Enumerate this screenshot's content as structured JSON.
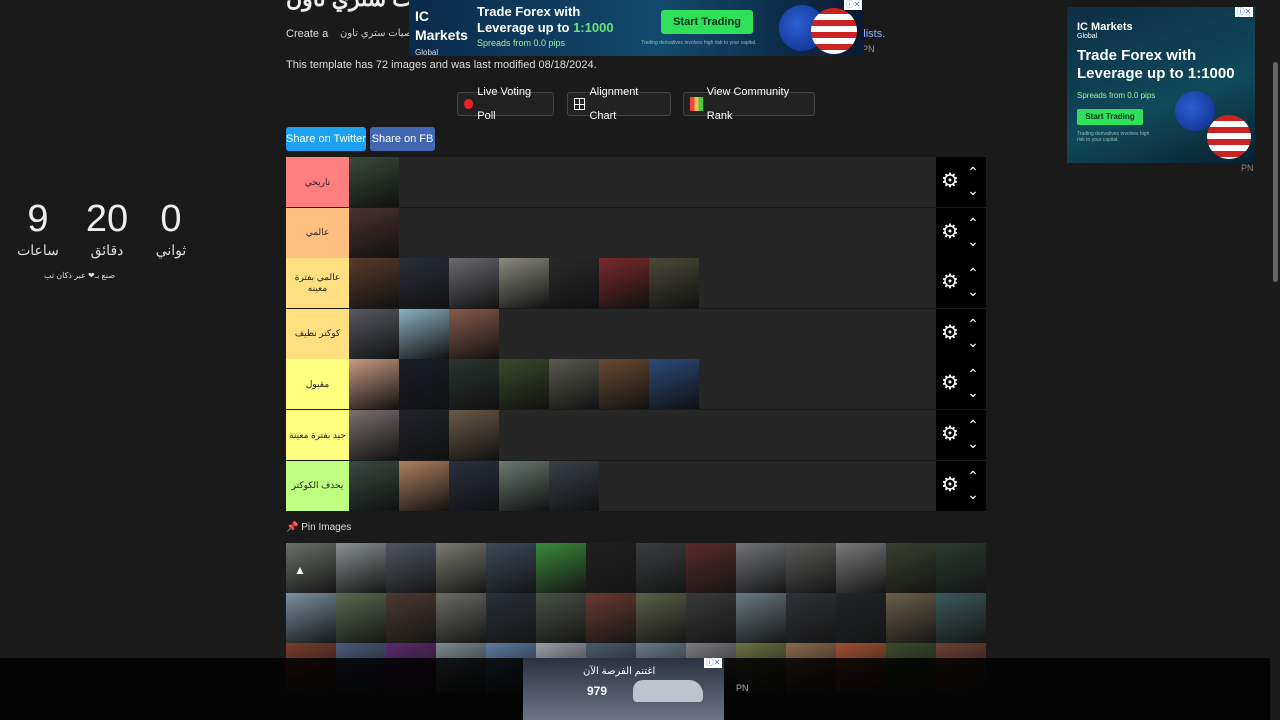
{
  "header": {
    "title": "قائمة شخصيات ستري تاون",
    "intro_start": "Create a",
    "intro_arabic": "شخصيات ستري تاون",
    "intro_link_tail": "ler lists.",
    "intro_pn": "PN",
    "template_info": "This template has 72 images and was last modified 08/18/2024."
  },
  "top_ad": {
    "brand": "IC Markets",
    "brand_sub": "Global",
    "headline_1": "Trade Forex with",
    "headline_2a": "Leverage up to ",
    "headline_2b": "1:1000",
    "sub": "Spreads from 0.0 pips",
    "cta": "Start Trading",
    "disclaimer": "Trading derivatives involves high risk to your capital."
  },
  "actions": {
    "live_voting": "Live Voting Poll",
    "alignment": "Alignment Chart",
    "community_rank": "View Community Rank",
    "share_twitter": "Share on Twitter",
    "share_fb": "Share on FB"
  },
  "tiers": [
    {
      "label": "تاريخي",
      "color": "#ff7f7f",
      "count": 1,
      "imgs": [
        "#3a4a3a"
      ]
    },
    {
      "label": "عالمي",
      "color": "#ffbf7f",
      "count": 1,
      "imgs": [
        "#4a3230"
      ]
    },
    {
      "label": "عالمي بفترة معينه",
      "color": "#ffdf7f",
      "count": 7,
      "imgs": [
        "#5a3b2a",
        "#2a2f3a",
        "#6a6a70",
        "#8a8a80",
        "#2a2a2a",
        "#7a2a2a",
        "#4a4a3a"
      ]
    },
    {
      "label": "كوكتر نظيف",
      "color": "#ffdf7f",
      "count": 3,
      "imgs": [
        "#555a60",
        "#8ab0c0",
        "#8a5a4a"
      ]
    },
    {
      "label": "مقبول",
      "color": "#ffff7f",
      "count": 7,
      "imgs": [
        "#c89a80",
        "#1a1e2a",
        "#2a3530",
        "#3a4a2a",
        "#5a5a50",
        "#6a4a30",
        "#2a4a7a"
      ]
    },
    {
      "label": "جيد بفترة معينة",
      "color": "#ffff7f",
      "count": 3,
      "imgs": [
        "#7a7070",
        "#20242a",
        "#6a5a48"
      ]
    },
    {
      "label": "يحذف الكوكتر",
      "color": "#bfff7f",
      "count": 5,
      "imgs": [
        "#3a4a40",
        "#b08060",
        "#2a3040",
        "#6a7a70",
        "#3a4048"
      ]
    }
  ],
  "pin_images_label": "Pin Images",
  "pool_colors": [
    "#6a7068",
    "#8a9090",
    "#505560",
    "#7a7a72",
    "#3a4a5a",
    "#3a8a3a",
    "#202020",
    "#3a3e40",
    "#5a2a2a",
    "#707478",
    "#5a5a58",
    "#7a7a7a",
    "#3a4030",
    "#2a3a30",
    "#7a90a0",
    "#5a6a50",
    "#4a3a30",
    "#6a6a66",
    "#2a3038",
    "#4a5048",
    "#6a3a30",
    "#5a6048",
    "#3a3a3a",
    "#6a7a80",
    "#303238",
    "#202428",
    "#6a6048",
    "#3a5a5a",
    "#7a3a2a",
    "#4a5a7a",
    "#5a2a6a",
    "#7a8a90",
    "#5a7aa0",
    "#9aa0a8",
    "#4a5a6a",
    "#6a7a8a",
    "#7a7a80",
    "#6a7040",
    "#8a6a4a",
    "#a05030",
    "#3a4a2a",
    "#6a4030"
  ],
  "countdown": {
    "hours": "9",
    "hours_label": "ساعات",
    "minutes": "20",
    "minutes_label": "دقائق",
    "seconds": "0",
    "seconds_label": "ثواني",
    "credit": "صنع بـ❤ عبر ذكان تب"
  },
  "side_ad": {
    "brand": "IC Markets",
    "brand_sub": "Global",
    "h1": "Trade Forex with",
    "h2": "Leverage up to 1:1000",
    "sub": "Spreads from 0.0 pips",
    "cta": "Start Trading",
    "disclaimer": "Trading derivatives involves high risk to your capital.",
    "pn": "PN"
  },
  "bottom_ad": {
    "headline": "اغتنم الفرصة الآن",
    "price": "979",
    "pn": "PN"
  }
}
